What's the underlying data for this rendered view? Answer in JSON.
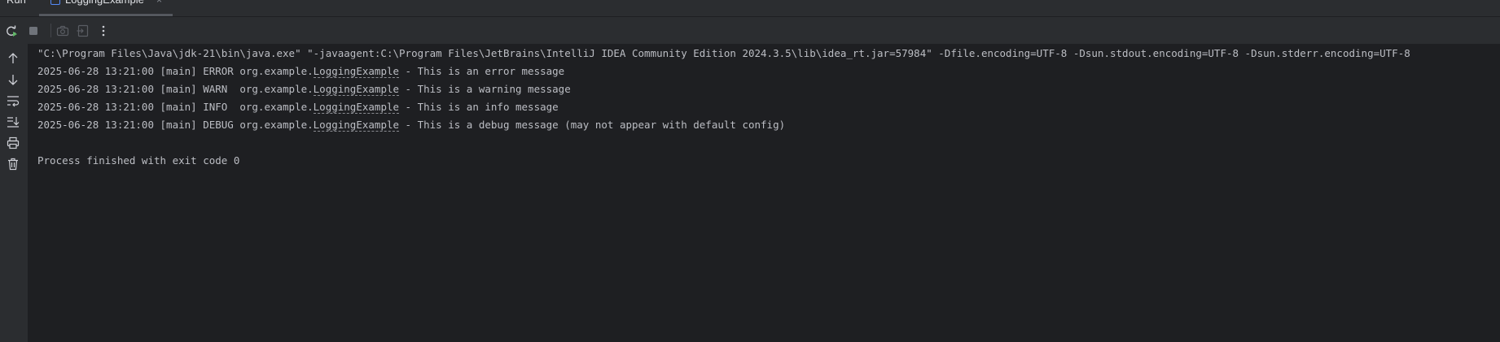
{
  "tool_window": {
    "title": "Run",
    "tab_label": "LoggingExample",
    "close_glyph": "×"
  },
  "toolbar": {
    "buttons": [
      "rerun-icon",
      "stop-icon",
      "camera-icon",
      "exit-icon",
      "more-icon"
    ]
  },
  "gutter": {
    "buttons": [
      "up-arrow-icon",
      "down-arrow-icon",
      "soft-wrap-icon",
      "scroll-to-end-icon",
      "print-icon",
      "trash-icon"
    ]
  },
  "console": {
    "command": "\"C:\\Program Files\\Java\\jdk-21\\bin\\java.exe\" \"-javaagent:C:\\Program Files\\JetBrains\\IntelliJ IDEA Community Edition 2024.3.5\\lib\\idea_rt.jar=57984\" -Dfile.encoding=UTF-8 -Dsun.stdout.encoding=UTF-8 -Dsun.stderr.encoding=UTF-8",
    "log_lines": [
      {
        "prefix": "2025-06-28 13:21:00 [main] ERROR org.example.",
        "link": "LoggingExample",
        "message": " - This is an error message"
      },
      {
        "prefix": "2025-06-28 13:21:00 [main] WARN  org.example.",
        "link": "LoggingExample",
        "message": " - This is a warning message"
      },
      {
        "prefix": "2025-06-28 13:21:00 [main] INFO  org.example.",
        "link": "LoggingExample",
        "message": " - This is an info message"
      },
      {
        "prefix": "2025-06-28 13:21:00 [main] DEBUG org.example.",
        "link": "LoggingExample",
        "message": " - This is a debug message (may not appear with default config)"
      }
    ],
    "exit_message": "Process finished with exit code 0"
  },
  "colors": {
    "console_bg": "#1e1f22",
    "panel_bg": "#2b2d30",
    "console_text": "#bcbec4",
    "rerun_green": "#5fb865",
    "tab_icon_blue": "#548af7"
  }
}
